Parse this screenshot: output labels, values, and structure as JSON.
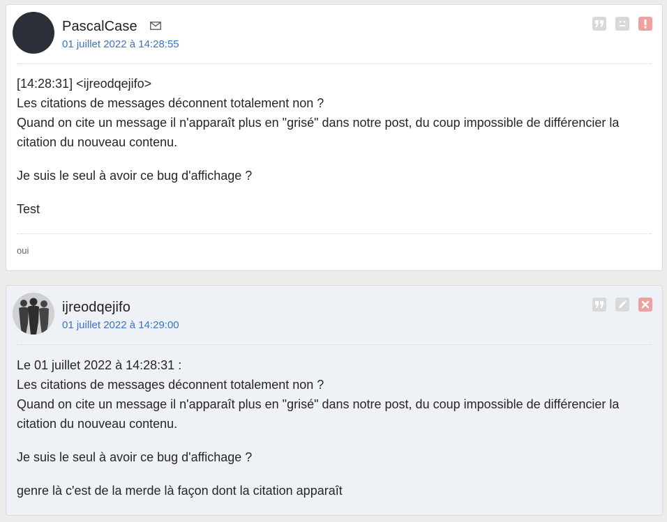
{
  "posts": [
    {
      "username": "PascalCase",
      "date": "01 juillet 2022 à 14:28:55",
      "body": [
        [
          "[14:28:31] <ijreodqejifo>",
          "Les citations de messages déconnent totalement non ?",
          "Quand on cite un message il n'apparaît plus en \"grisé\" dans notre post, du coup impossible de différencier la",
          "citation du nouveau contenu."
        ],
        [
          "Je suis le seul à avoir ce bug d'affichage ?"
        ],
        [
          "Test"
        ]
      ],
      "signature": "oui",
      "actions": [
        "quote-icon",
        "sad-face-icon",
        "report-icon"
      ]
    },
    {
      "username": "ijreodqejifo",
      "date": "01 juillet 2022 à 14:29:00",
      "body": [
        [
          "Le 01 juillet 2022 à 14:28:31 :",
          "Les citations de messages déconnent totalement non ?",
          "Quand on cite un message il n'apparaît plus en \"grisé\" dans notre post, du coup impossible de différencier la",
          "citation du nouveau contenu."
        ],
        [
          "Je suis le seul à avoir ce bug d'affichage ?"
        ],
        [
          "genre là c'est de la merde là façon dont la citation apparaît"
        ]
      ],
      "actions": [
        "quote-icon",
        "edit-icon",
        "delete-icon"
      ]
    }
  ],
  "colors": {
    "page_background": "#ececec",
    "link_blue": "#3a72c6",
    "own_post_background": "#eef1f5",
    "danger_red": "#f0a0a0"
  }
}
